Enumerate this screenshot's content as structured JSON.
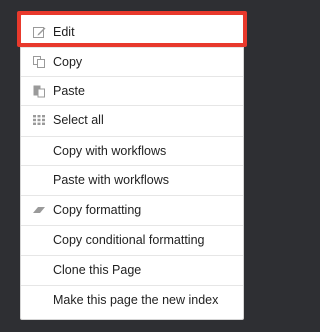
{
  "menu": {
    "items": [
      {
        "label": "Edit",
        "icon": "edit-icon"
      },
      {
        "label": "Copy",
        "icon": "copy-icon"
      },
      {
        "label": "Paste",
        "icon": "paste-icon"
      },
      {
        "label": "Select all",
        "icon": "select-all-icon"
      },
      {
        "label": "Copy with workflows",
        "icon": ""
      },
      {
        "label": "Paste with workflows",
        "icon": ""
      },
      {
        "label": "Copy formatting",
        "icon": "copy-formatting-icon"
      },
      {
        "label": "Copy conditional formatting",
        "icon": ""
      },
      {
        "label": "Clone this Page",
        "icon": ""
      },
      {
        "label": "Make this page the new index",
        "icon": ""
      }
    ]
  },
  "colors": {
    "backdrop": "#2e2f33",
    "highlight_border": "#e8392c",
    "menu_background": "#ffffff",
    "icon": "#9a9a9a"
  }
}
